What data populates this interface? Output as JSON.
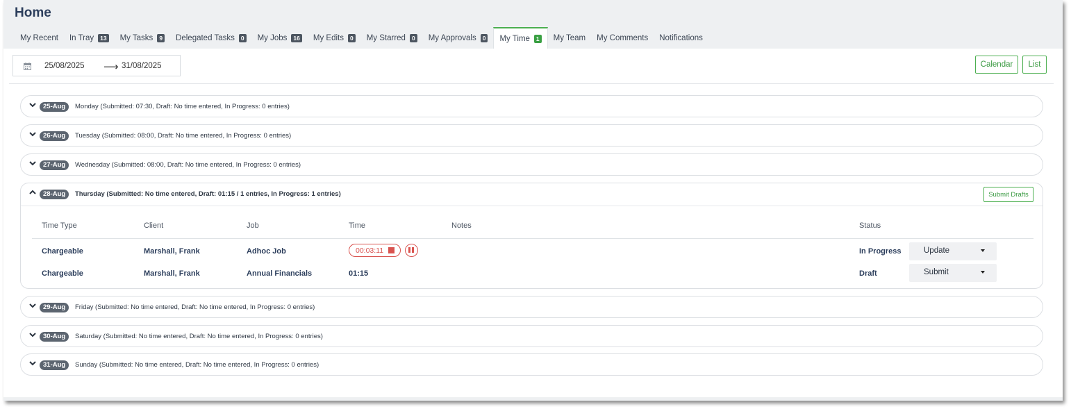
{
  "page": {
    "title": "Home"
  },
  "tabs": [
    {
      "label": "My Recent"
    },
    {
      "label": "In Tray",
      "count": "13"
    },
    {
      "label": "My Tasks",
      "count": "9"
    },
    {
      "label": "Delegated Tasks",
      "count": "0"
    },
    {
      "label": "My Jobs",
      "count": "16"
    },
    {
      "label": "My Edits",
      "count": "0"
    },
    {
      "label": "My Starred",
      "count": "0"
    },
    {
      "label": "My Approvals",
      "count": "0"
    },
    {
      "label": "My Time",
      "count": "1",
      "active": true
    },
    {
      "label": "My Team"
    },
    {
      "label": "My Comments"
    },
    {
      "label": "Notifications"
    }
  ],
  "date_range": {
    "start": "25/08/2025",
    "end": "31/08/2025",
    "arrow": "⟶"
  },
  "view_buttons": {
    "calendar": "Calendar",
    "list": "List"
  },
  "days": [
    {
      "tag": "25-Aug",
      "summary": "Monday (Submitted: 07:30, Draft: No time entered, In Progress: 0 entries)"
    },
    {
      "tag": "26-Aug",
      "summary": "Tuesday (Submitted: 08:00, Draft: No time entered, In Progress: 0 entries)"
    },
    {
      "tag": "27-Aug",
      "summary": "Wednesday (Submitted: 08:00, Draft: No time entered, In Progress: 0 entries)"
    },
    {
      "tag": "28-Aug",
      "summary": "Thursday (Submitted: No time entered, Draft: 01:15 / 1 entries, In Progress: 1 entries)",
      "expanded": true
    },
    {
      "tag": "29-Aug",
      "summary": "Friday (Submitted: No time entered, Draft: No time entered, In Progress: 0 entries)"
    },
    {
      "tag": "30-Aug",
      "summary": "Saturday (Submitted: No time entered, Draft: No time entered, In Progress: 0 entries)"
    },
    {
      "tag": "31-Aug",
      "summary": "Sunday (Submitted: No time entered, Draft: No time entered, In Progress: 0 entries)"
    }
  ],
  "expanded_day": {
    "submit_drafts_label": "Submit Drafts",
    "columns": {
      "time_type": "Time Type",
      "client": "Client",
      "job": "Job",
      "time": "Time",
      "notes": "Notes",
      "status": "Status"
    },
    "entries": [
      {
        "time_type": "Chargeable",
        "client": "Marshall, Frank",
        "job": "Adhoc Job",
        "time": "00:03:11",
        "status": "In Progress",
        "action": "Update",
        "running": true
      },
      {
        "time_type": "Chargeable",
        "client": "Marshall, Frank",
        "job": "Annual Financials",
        "time": "01:15",
        "status": "Draft",
        "action": "Submit"
      }
    ]
  },
  "colors": {
    "accent": "#4caf50",
    "timer": "#d9534f",
    "title": "#2c3e5c",
    "badge": "#4d5661"
  }
}
